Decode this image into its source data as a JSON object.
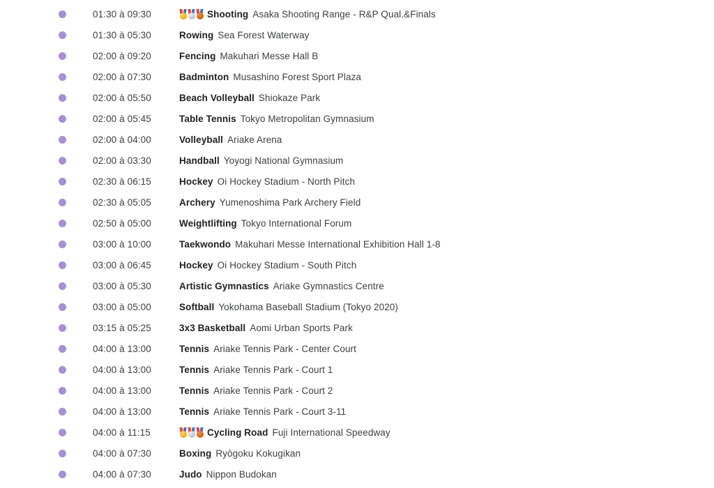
{
  "page": {
    "background_color": "#ffffff",
    "bullet_color": "#a78fd4",
    "text_color": "#3c4043",
    "sport_color": "#202124",
    "separator_label": "à"
  },
  "schedule": {
    "rows": [
      {
        "time": "01:30 à 09:30",
        "medals": true,
        "sport": "Shooting",
        "venue": "Asaka Shooting Range - R&P Qual.&Finals"
      },
      {
        "time": "01:30 à 05:30",
        "medals": false,
        "sport": "Rowing",
        "venue": "Sea Forest Waterway"
      },
      {
        "time": "02:00 à 09:20",
        "medals": false,
        "sport": "Fencing",
        "venue": "Makuhari Messe Hall B"
      },
      {
        "time": "02:00 à 07:30",
        "medals": false,
        "sport": "Badminton",
        "venue": "Musashino Forest Sport Plaza"
      },
      {
        "time": "02:00 à 05:50",
        "medals": false,
        "sport": "Beach Volleyball",
        "venue": "Shiokaze Park"
      },
      {
        "time": "02:00 à 05:45",
        "medals": false,
        "sport": "Table Tennis",
        "venue": "Tokyo Metropolitan Gymnasium"
      },
      {
        "time": "02:00 à 04:00",
        "medals": false,
        "sport": "Volleyball",
        "venue": "Ariake Arena"
      },
      {
        "time": "02:00 à 03:30",
        "medals": false,
        "sport": "Handball",
        "venue": "Yoyogi National Gymnasium"
      },
      {
        "time": "02:30 à 06:15",
        "medals": false,
        "sport": "Hockey",
        "venue": "Oi Hockey Stadium - North Pitch"
      },
      {
        "time": "02:30 à 05:05",
        "medals": false,
        "sport": "Archery",
        "venue": "Yumenoshima Park Archery Field"
      },
      {
        "time": "02:50 à 05:00",
        "medals": false,
        "sport": "Weightlifting",
        "venue": "Tokyo International Forum"
      },
      {
        "time": "03:00 à 10:00",
        "medals": false,
        "sport": "Taekwondo",
        "venue": "Makuhari Messe International Exhibition Hall 1-8"
      },
      {
        "time": "03:00 à 06:45",
        "medals": false,
        "sport": "Hockey",
        "venue": "Oi Hockey Stadium - South Pitch"
      },
      {
        "time": "03:00 à 05:30",
        "medals": false,
        "sport": "Artistic Gymnastics",
        "venue": "Ariake Gymnastics Centre"
      },
      {
        "time": "03:00 à 05:00",
        "medals": false,
        "sport": "Softball",
        "venue": "Yokohama Baseball Stadium (Tokyo 2020)"
      },
      {
        "time": "03:15 à 05:25",
        "medals": false,
        "sport": "3x3 Basketball",
        "venue": "Aomi Urban Sports Park"
      },
      {
        "time": "04:00 à 13:00",
        "medals": false,
        "sport": "Tennis",
        "venue": "Ariake Tennis Park - Center Court"
      },
      {
        "time": "04:00 à 13:00",
        "medals": false,
        "sport": "Tennis",
        "venue": "Ariake Tennis Park - Court 1"
      },
      {
        "time": "04:00 à 13:00",
        "medals": false,
        "sport": "Tennis",
        "venue": "Ariake Tennis Park - Court 2"
      },
      {
        "time": "04:00 à 13:00",
        "medals": false,
        "sport": "Tennis",
        "venue": "Ariake Tennis Park - Court 3-11"
      },
      {
        "time": "04:00 à 11:15",
        "medals": true,
        "sport": "Cycling Road",
        "venue": "Fuji International Speedway"
      },
      {
        "time": "04:00 à 07:30",
        "medals": false,
        "sport": "Boxing",
        "venue": "Ryōgoku Kokugikan"
      },
      {
        "time": "04:00 à 07:30",
        "medals": false,
        "sport": "Judo",
        "venue": "Nippon Budokan"
      }
    ],
    "medal_icons": [
      "gold-medal-icon",
      "silver-medal-icon",
      "bronze-medal-icon"
    ]
  }
}
